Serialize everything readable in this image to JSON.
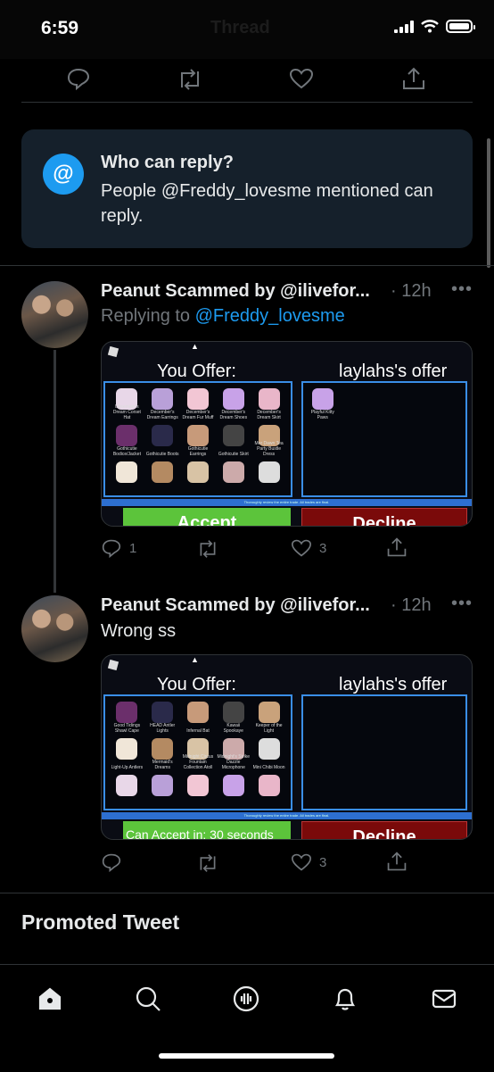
{
  "status_bar": {
    "time": "6:59",
    "battery_level": 0.85
  },
  "header": {
    "title": "Thread"
  },
  "reply_restriction": {
    "icon": "at-sign-icon",
    "title": "Who can reply?",
    "text": "People @Freddy_lovesme mentioned can reply."
  },
  "tweets": [
    {
      "name": "Peanut Scammed by @ilivefor...",
      "time": "· 12h",
      "more": "•••",
      "replying_prefix": "Replying to",
      "replying_handle": "@Freddy_lovesme",
      "image": {
        "you_offer": "You Offer:",
        "their_offer": "laylahs's offer",
        "accept_label": "Accept",
        "decline_label": "Decline",
        "left_counter": "0",
        "right_counter": "0",
        "items": [
          "December's Dream Corset Hat",
          "December's Dream Earrings",
          "December's Dream Fur Muff",
          "December's Dream Shoes",
          "December's Dream Skirt",
          "Gothicutie Bodice/Jacket",
          "Gothicutie Boots",
          "Gothicutie Earrings",
          "Gothicutie Skirt",
          "Mer Dawn Tea Party Bustle Dress",
          "",
          "",
          "",
          "",
          ""
        ],
        "their_items": [
          "Playful Kitty Paws"
        ]
      },
      "actions": {
        "replies": "1",
        "retweets": "",
        "likes": "3"
      }
    },
    {
      "name": "Peanut Scammed by @ilivefor...",
      "time": "· 12h",
      "more": "•••",
      "text": "Wrong ss",
      "image": {
        "you_offer": "You Offer:",
        "their_offer": "laylahs's offer",
        "accept_label": "Can Accept in: 30 seconds",
        "decline_label": "Decline",
        "left_counter": "0",
        "right_counter": "0",
        "top_row": [
          "Dew Drop Mist",
          "DIY Antlers Chest Flowers",
          "DIY Antlers Head Flowers",
          "Festive Hair Bow",
          "Gold Keeper"
        ],
        "items": [
          "Good Tidings Shawl Cape",
          "HEAD Antler Lights",
          "Infernal Bat",
          "Kawaii Spookaye",
          "Keeper of the Light",
          "Light-Up Antlers",
          "Mermaid's Dreams",
          "Midnight Circus Fountain Collection Atoll",
          "Midnight's Strike Dazzle Microphone",
          "Mini Chibi Moon",
          "",
          "",
          "",
          "",
          ""
        ]
      },
      "actions": {
        "replies": "",
        "retweets": "",
        "likes": "3"
      }
    }
  ],
  "promoted": {
    "label": "Promoted Tweet"
  },
  "tab_bar": {
    "tabs": [
      "home-icon",
      "search-icon",
      "spaces-icon",
      "notifications-icon",
      "messages-icon"
    ]
  },
  "colors": {
    "accent": "#1d9bf0",
    "card": "#15202b",
    "accept": "#5cc43b",
    "decline": "#7a0a0a"
  }
}
